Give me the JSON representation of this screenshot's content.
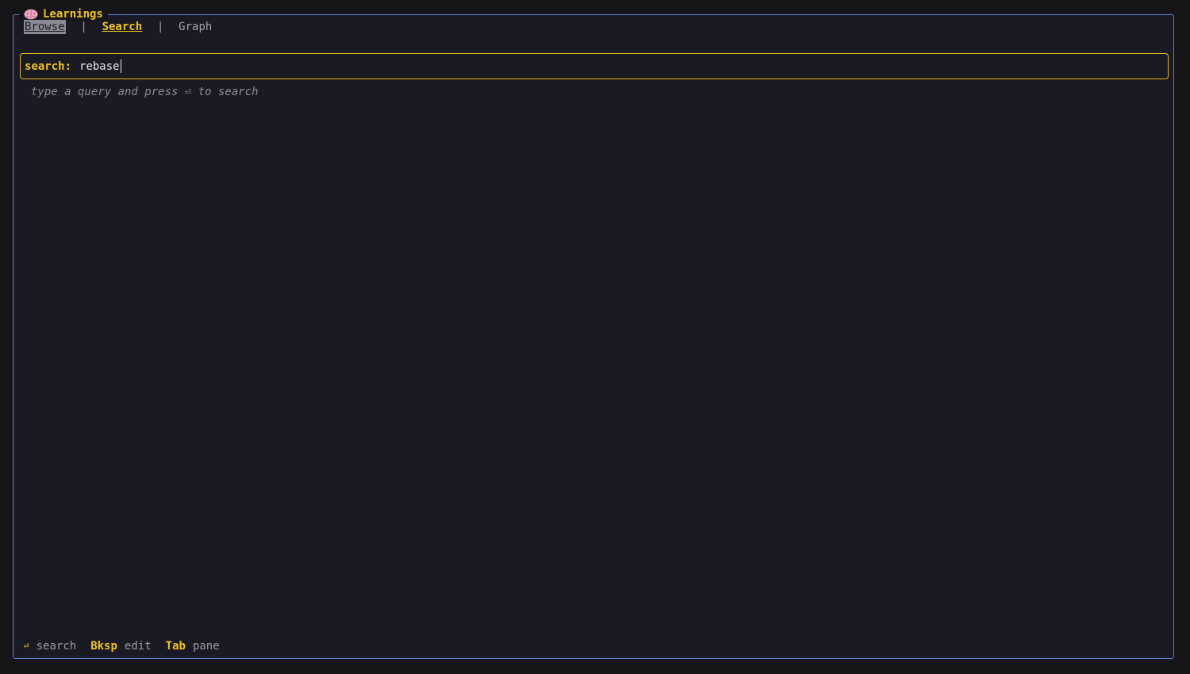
{
  "app": {
    "title": "Learnings",
    "icon": "brain-icon"
  },
  "tabs": [
    {
      "label": "Browse",
      "state": "highlighted"
    },
    {
      "label": "Search",
      "state": "active"
    },
    {
      "label": "Graph",
      "state": "inactive"
    }
  ],
  "tab_separator": "|",
  "search": {
    "label": "search:",
    "value": "rebase"
  },
  "hint": "type a query and press ⏎ to search",
  "footer": [
    {
      "key": "⏎",
      "desc": "search"
    },
    {
      "key": "Bksp",
      "desc": "edit"
    },
    {
      "key": "Tab",
      "desc": "pane"
    }
  ],
  "colors": {
    "accent": "#f0c419",
    "frame_border": "#5b7fd1",
    "background": "#191a24"
  }
}
